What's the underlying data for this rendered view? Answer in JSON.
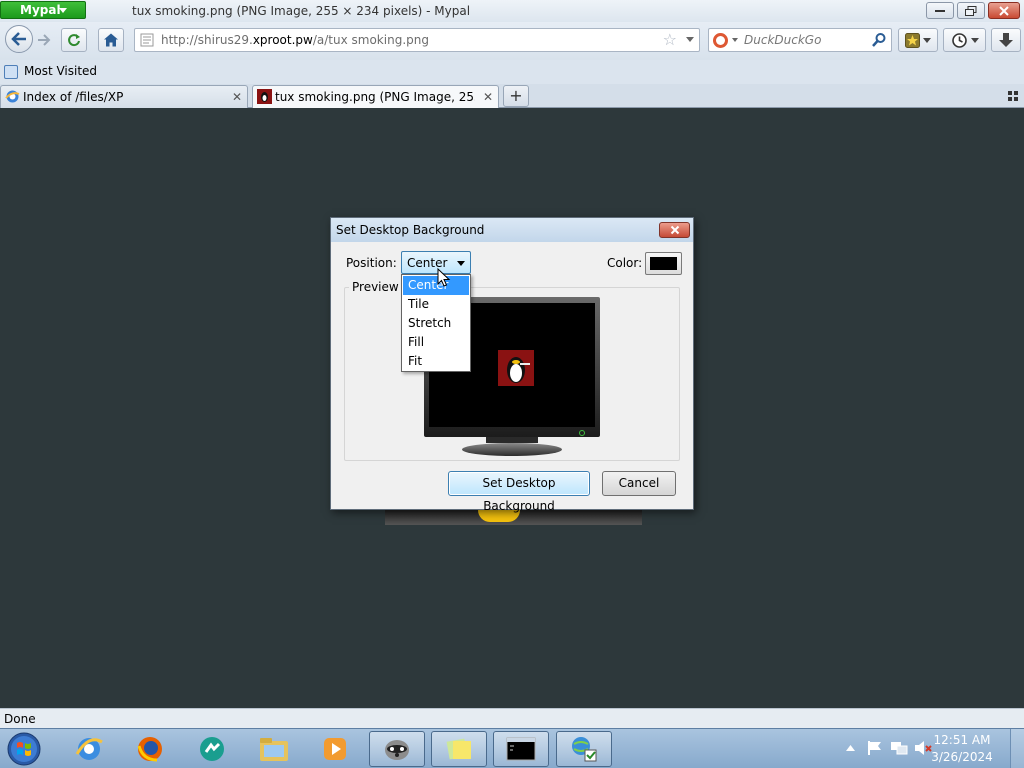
{
  "window": {
    "app_menu_label": "Mypal",
    "title": "tux smoking.png (PNG Image, 255 × 234 pixels) - Mypal"
  },
  "navbar": {
    "url_prefix": "http://shirus29.",
    "url_host": "xproot.pw",
    "url_suffix": "/a/tux smoking.png",
    "search_placeholder": "DuckDuckGo"
  },
  "bookmarks": {
    "most_visited": "Most Visited"
  },
  "tabs": [
    {
      "label": "Index of /files/XP",
      "close": "✕"
    },
    {
      "label": "tux smoking.png (PNG Image, 255 × ...",
      "close": "✕"
    }
  ],
  "newtab_label": "+",
  "dialog": {
    "title": "Set Desktop Background",
    "position_label": "Position:",
    "position_value": "Center",
    "color_label": "Color:",
    "color_value": "#000000",
    "preview_label": "Preview",
    "options": [
      "Center",
      "Tile",
      "Stretch",
      "Fill",
      "Fit"
    ],
    "selected_option": "Center",
    "set_button": "Set Desktop Background",
    "cancel_button": "Cancel"
  },
  "status": {
    "text": "Done"
  },
  "taskbar": {
    "items": [
      "internet-explorer-icon",
      "firefox-icon",
      "messenger-icon",
      "explorer-folder-icon",
      "media-player-icon",
      "mypal-raccoon-icon",
      "sticky-notes-icon",
      "command-prompt-icon",
      "network-settings-icon"
    ],
    "clock_time": "12:51 AM",
    "clock_date": "3/26/2024"
  },
  "colors": {
    "page_background": "#2d383b",
    "menu_green": "#1d9a1c",
    "selection_blue": "#3399ff"
  }
}
